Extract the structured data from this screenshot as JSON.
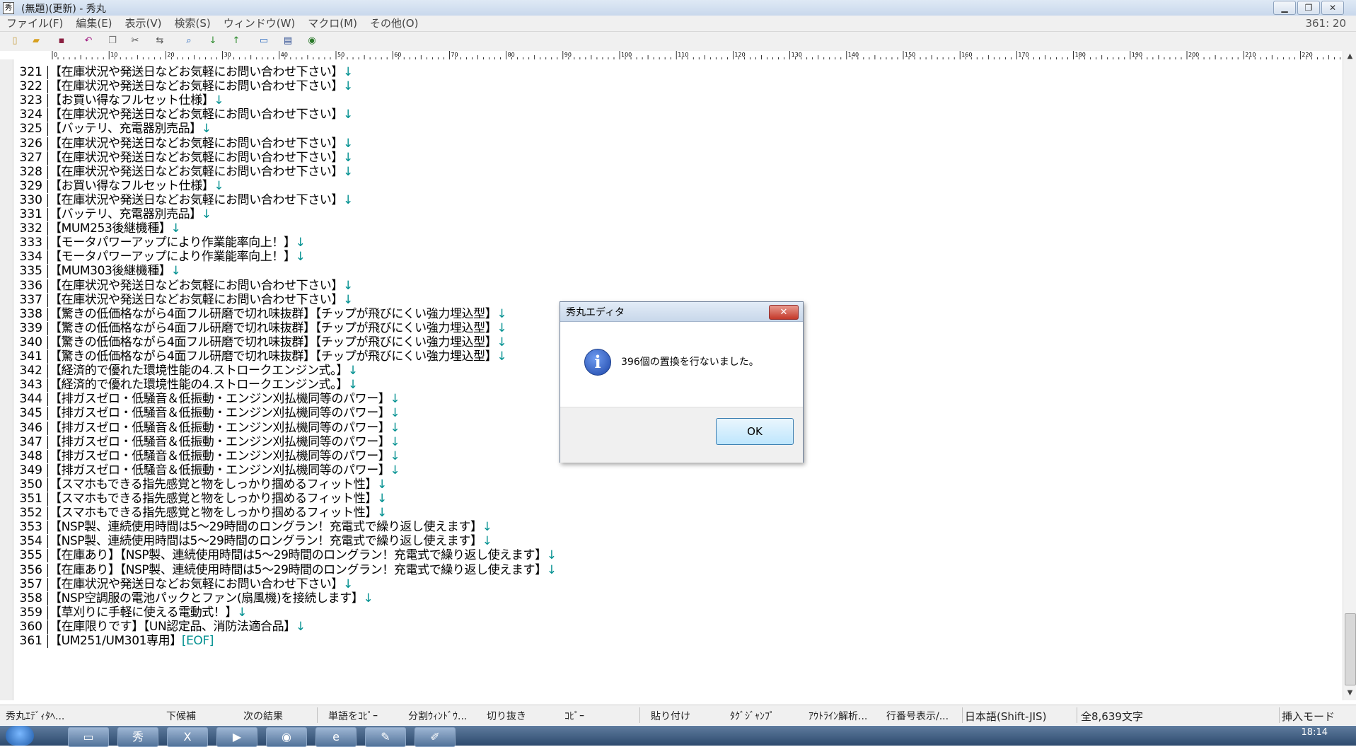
{
  "window": {
    "title": "(無題)(更新) - 秀丸",
    "app_icon": "hidemaru-app-icon",
    "minimize": "▁",
    "restore": "❐",
    "close": "✕"
  },
  "menu": {
    "items": [
      "ファイル(F)",
      "編集(E)",
      "表示(V)",
      "検索(S)",
      "ウィンドウ(W)",
      "マクロ(M)",
      "その他(O)"
    ],
    "cursor_position": "361: 20"
  },
  "toolbar": {
    "icons": [
      "new-file-icon",
      "open-folder-icon",
      "save-icon",
      "undo-icon",
      "copy-icon",
      "cut-icon",
      "replace-icon",
      "search-icon",
      "search-down-icon",
      "search-up-icon",
      "grep-icon",
      "window-split-icon",
      "help-icon"
    ]
  },
  "ruler": {
    "labels": [
      "0",
      "10",
      "20",
      "30",
      "40",
      "50",
      "60",
      "70",
      "80",
      "90",
      "100",
      "110",
      "120",
      "130",
      "140",
      "150",
      "160",
      "170",
      "180",
      "190",
      "200",
      "210",
      "220"
    ]
  },
  "editor": {
    "eol_mark": "↓",
    "eof_mark": "[EOF]",
    "lines": [
      {
        "n": "321",
        "text": "【在庫状況や発送日などお気軽にお問い合わせ下さい】"
      },
      {
        "n": "322",
        "text": "【在庫状況や発送日などお気軽にお問い合わせ下さい】"
      },
      {
        "n": "323",
        "text": "【お買い得なフルセット仕様】"
      },
      {
        "n": "324",
        "text": "【在庫状況や発送日などお気軽にお問い合わせ下さい】"
      },
      {
        "n": "325",
        "text": "【バッテリ、充電器別売品】"
      },
      {
        "n": "326",
        "text": "【在庫状況や発送日などお気軽にお問い合わせ下さい】"
      },
      {
        "n": "327",
        "text": "【在庫状況や発送日などお気軽にお問い合わせ下さい】"
      },
      {
        "n": "328",
        "text": "【在庫状況や発送日などお気軽にお問い合わせ下さい】"
      },
      {
        "n": "329",
        "text": "【お買い得なフルセット仕様】"
      },
      {
        "n": "330",
        "text": "【在庫状況や発送日などお気軽にお問い合わせ下さい】"
      },
      {
        "n": "331",
        "text": "【バッテリ、充電器別売品】"
      },
      {
        "n": "332",
        "text": "【MUM253後継機種】"
      },
      {
        "n": "333",
        "text": "【モータパワーアップにより作業能率向上！】"
      },
      {
        "n": "334",
        "text": "【モータパワーアップにより作業能率向上！】"
      },
      {
        "n": "335",
        "text": "【MUM303後継機種】"
      },
      {
        "n": "336",
        "text": "【在庫状況や発送日などお気軽にお問い合わせ下さい】"
      },
      {
        "n": "337",
        "text": "【在庫状況や発送日などお気軽にお問い合わせ下さい】"
      },
      {
        "n": "338",
        "text": "【驚きの低価格ながら4面フル研磨で切れ味抜群】【チップが飛びにくい強力埋込型】"
      },
      {
        "n": "339",
        "text": "【驚きの低価格ながら4面フル研磨で切れ味抜群】【チップが飛びにくい強力埋込型】"
      },
      {
        "n": "340",
        "text": "【驚きの低価格ながら4面フル研磨で切れ味抜群】【チップが飛びにくい強力埋込型】"
      },
      {
        "n": "341",
        "text": "【驚きの低価格ながら4面フル研磨で切れ味抜群】【チップが飛びにくい強力埋込型】"
      },
      {
        "n": "342",
        "text": "【経済的で優れた環境性能の4.ストロークエンジン式。】"
      },
      {
        "n": "343",
        "text": "【経済的で優れた環境性能の4.ストロークエンジン式。】"
      },
      {
        "n": "344",
        "text": "【排ガスゼロ・低騒音＆低振動・エンジン刈払機同等のパワー】"
      },
      {
        "n": "345",
        "text": "【排ガスゼロ・低騒音＆低振動・エンジン刈払機同等のパワー】"
      },
      {
        "n": "346",
        "text": "【排ガスゼロ・低騒音＆低振動・エンジン刈払機同等のパワー】"
      },
      {
        "n": "347",
        "text": "【排ガスゼロ・低騒音＆低振動・エンジン刈払機同等のパワー】"
      },
      {
        "n": "348",
        "text": "【排ガスゼロ・低騒音＆低振動・エンジン刈払機同等のパワー】"
      },
      {
        "n": "349",
        "text": "【排ガスゼロ・低騒音＆低振動・エンジン刈払機同等のパワー】"
      },
      {
        "n": "350",
        "text": "【スマホもできる指先感覚と物をしっかり掴めるフィット性】"
      },
      {
        "n": "351",
        "text": "【スマホもできる指先感覚と物をしっかり掴めるフィット性】"
      },
      {
        "n": "352",
        "text": "【スマホもできる指先感覚と物をしっかり掴めるフィット性】"
      },
      {
        "n": "353",
        "text": "【NSP製、連続使用時間は5～29時間のロングラン！充電式で繰り返し使えます】"
      },
      {
        "n": "354",
        "text": "【NSP製、連続使用時間は5～29時間のロングラン！充電式で繰り返し使えます】"
      },
      {
        "n": "355",
        "text": "【在庫あり】【NSP製、連続使用時間は5～29時間のロングラン！充電式で繰り返し使えます】"
      },
      {
        "n": "356",
        "text": "【在庫あり】【NSP製、連続使用時間は5～29時間のロングラン！充電式で繰り返し使えます】"
      },
      {
        "n": "357",
        "text": "【在庫状況や発送日などお気軽にお問い合わせ下さい】"
      },
      {
        "n": "358",
        "text": "【NSP空調服の電池パックとファン(扇風機)を接続します】"
      },
      {
        "n": "359",
        "text": "【草刈りに手軽に使える電動式！】"
      },
      {
        "n": "360",
        "text": "【在庫限りです】【UN認定品、消防法適合品】"
      },
      {
        "n": "361",
        "text": "【UM251/UM301専用】"
      }
    ]
  },
  "funcbar": {
    "keys": [
      "秀丸ｴﾃﾞｨﾀﾍ...",
      "下候補",
      "次の結果",
      "単語をｺﾋﾟｰ",
      "分割ｳｨﾝﾄﾞｳ...",
      "切り抜き",
      "ｺﾋﾟｰ",
      "貼り付け",
      "ﾀｸﾞｼﾞｬﾝﾌﾟ",
      "ｱｳﾄﾗｲﾝ解析...",
      "行番号表示/..."
    ],
    "encoding": "日本語(Shift-JIS)",
    "char_count": "全8,639文字",
    "mode": "挿入モード"
  },
  "taskbar": {
    "clock": "18:14",
    "apps": [
      "folder-app",
      "hidemaru-app",
      "excel-app",
      "media-player-app",
      "firefox-app",
      "internet-explorer-app",
      "paint-app",
      "paint-brush-app"
    ],
    "app_glyphs": [
      "▭",
      "秀",
      "X",
      "▶",
      "◉",
      "e",
      "✎",
      "✐"
    ]
  },
  "dialog": {
    "title": "秀丸エディタ",
    "close": "✕",
    "icon_glyph": "i",
    "message": "396個の置換を行ないました。",
    "ok_label": "OK"
  }
}
